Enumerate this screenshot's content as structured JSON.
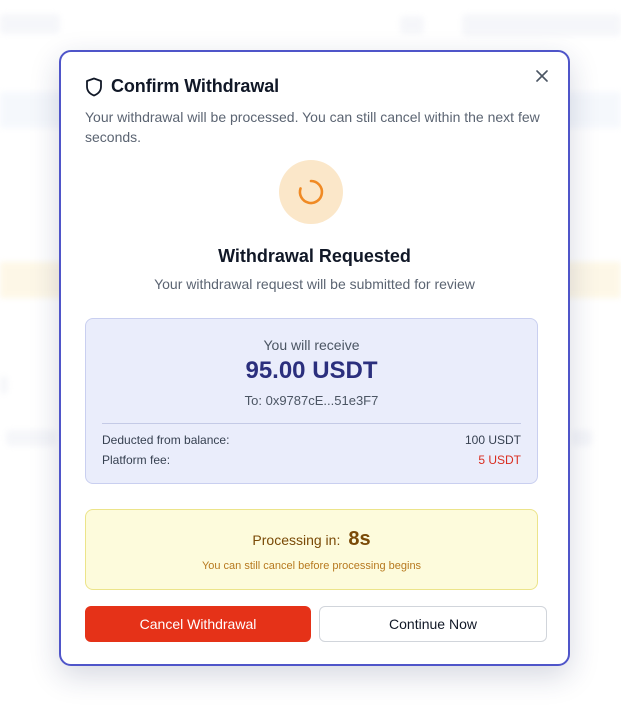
{
  "dialog": {
    "title": "Confirm Withdrawal",
    "description": "Your withdrawal will be processed. You can still cancel within the next few seconds.",
    "close_icon": "close-icon",
    "header_icon": "shield-icon"
  },
  "status": {
    "icon": "loading-spinner-icon",
    "title": "Withdrawal Requested",
    "subtitle": "Your withdrawal request will be submitted for review"
  },
  "summary": {
    "receive_label": "You will receive",
    "receive_amount": "95.00 USDT",
    "to_address": "To: 0x9787cE...51e3F7",
    "rows": [
      {
        "label": "Deducted from balance:",
        "value": "100 USDT"
      },
      {
        "label": "Platform fee:",
        "value": "5 USDT"
      }
    ]
  },
  "processing": {
    "label": "Processing in:",
    "countdown": "8s",
    "note": "You can still cancel before processing begins"
  },
  "buttons": {
    "cancel": "Cancel Withdrawal",
    "continue": "Continue Now"
  },
  "colors": {
    "accent": "#4f55c9",
    "danger": "#e53218",
    "warning_bg": "#fdfbdc",
    "summary_bg": "#eaedfb",
    "spinner": "#f08a24"
  }
}
